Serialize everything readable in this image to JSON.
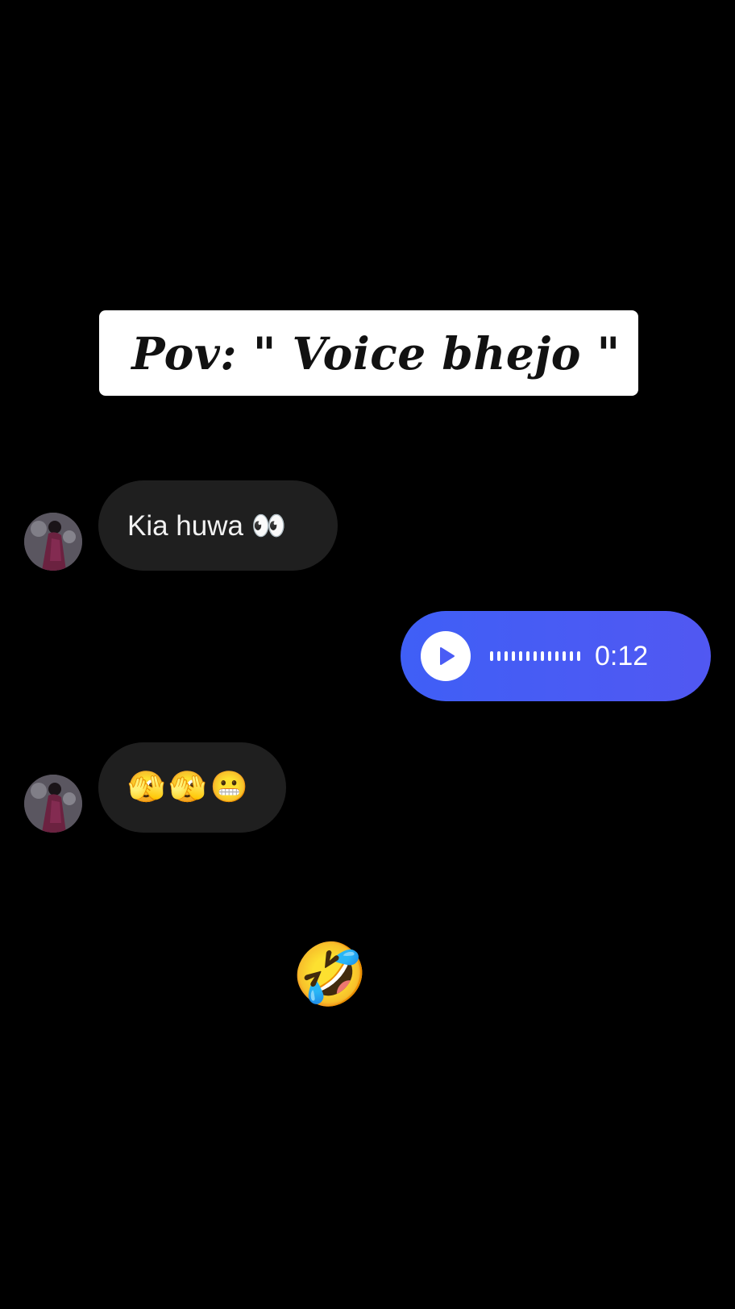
{
  "caption": {
    "text": "Pov: \" Voice bhejo \""
  },
  "messages": [
    {
      "direction": "incoming",
      "type": "text",
      "text": "Kia huwa 👀",
      "avatar_icon": "profile-photo-avatar"
    },
    {
      "direction": "outgoing",
      "type": "voice",
      "duration": "0:12",
      "play_icon": "play-icon",
      "bubble_color": "#4a5cf5"
    },
    {
      "direction": "incoming",
      "type": "text",
      "text": "🫣🫣😬",
      "avatar_icon": "profile-photo-avatar"
    }
  ],
  "reaction_overlay": {
    "text": "🤣😂"
  },
  "colors": {
    "background": "#000000",
    "incoming_bubble": "#1f1f1f",
    "outgoing_voice_bubble": "#4a5cf5",
    "caption_background": "#ffffff"
  }
}
